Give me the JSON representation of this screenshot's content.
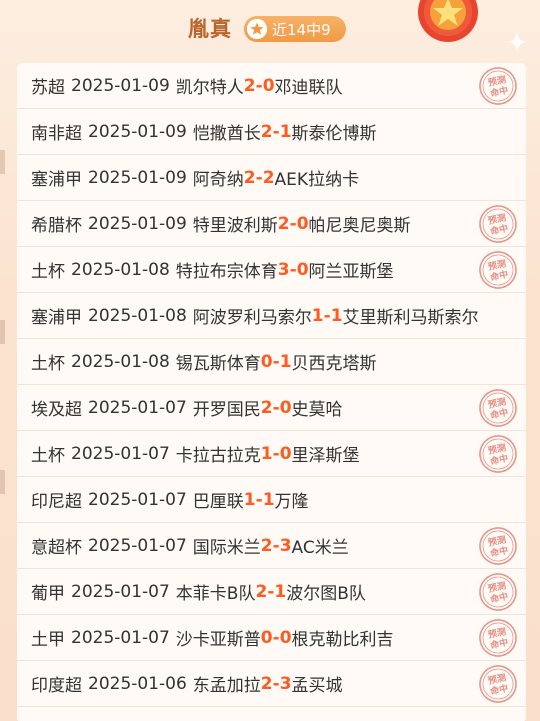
{
  "header": {
    "title": "胤真",
    "badge_text": "近14中9"
  },
  "stamp_text": "预测命中",
  "colors": {
    "accent": "#ff5a1f",
    "title": "#b8662c"
  },
  "matches": [
    {
      "league": "苏超",
      "date": "2025-01-09",
      "home": "凯尔特人",
      "hs": "2",
      "as": "0",
      "away": "邓迪联队",
      "hit": true
    },
    {
      "league": "南非超",
      "date": "2025-01-09",
      "home": "恺撒酋长",
      "hs": "2",
      "as": "1",
      "away": "斯泰伦博斯",
      "hit": false
    },
    {
      "league": "塞浦甲",
      "date": "2025-01-09",
      "home": "阿奇纳",
      "hs": "2",
      "as": "2",
      "away": "AEK拉纳卡",
      "hit": false
    },
    {
      "league": "希腊杯",
      "date": "2025-01-09",
      "home": "特里波利斯",
      "hs": "2",
      "as": "0",
      "away": "帕尼奥尼奥斯",
      "hit": true
    },
    {
      "league": "土杯",
      "date": "2025-01-08",
      "home": "特拉布宗体育",
      "hs": "3",
      "as": "0",
      "away": "阿兰亚斯堡",
      "hit": true
    },
    {
      "league": "塞浦甲",
      "date": "2025-01-08",
      "home": "阿波罗利马索尔",
      "hs": "1",
      "as": "1",
      "away": "艾里斯利马斯索尔",
      "hit": false
    },
    {
      "league": "土杯",
      "date": "2025-01-08",
      "home": "锡瓦斯体育",
      "hs": "0",
      "as": "1",
      "away": "贝西克塔斯",
      "hit": false
    },
    {
      "league": "埃及超",
      "date": "2025-01-07",
      "home": "开罗国民",
      "hs": "2",
      "as": "0",
      "away": "史莫哈",
      "hit": true
    },
    {
      "league": "土杯",
      "date": "2025-01-07",
      "home": "卡拉古拉克",
      "hs": "1",
      "as": "0",
      "away": "里泽斯堡",
      "hit": true
    },
    {
      "league": "印尼超",
      "date": "2025-01-07",
      "home": "巴厘联",
      "hs": "1",
      "as": "1",
      "away": "万隆",
      "hit": false
    },
    {
      "league": "意超杯",
      "date": "2025-01-07",
      "home": "国际米兰",
      "hs": "2",
      "as": "3",
      "away": "AC米兰",
      "hit": true
    },
    {
      "league": "葡甲",
      "date": "2025-01-07",
      "home": "本菲卡B队",
      "hs": "2",
      "as": "1",
      "away": "波尔图B队",
      "hit": true
    },
    {
      "league": "土甲",
      "date": "2025-01-07",
      "home": "沙卡亚斯普",
      "hs": "0",
      "as": "0",
      "away": "根克勒比利吉",
      "hit": true
    },
    {
      "league": "印度超",
      "date": "2025-01-06",
      "home": "东孟加拉",
      "hs": "2",
      "as": "3",
      "away": "孟买城",
      "hit": true
    }
  ]
}
